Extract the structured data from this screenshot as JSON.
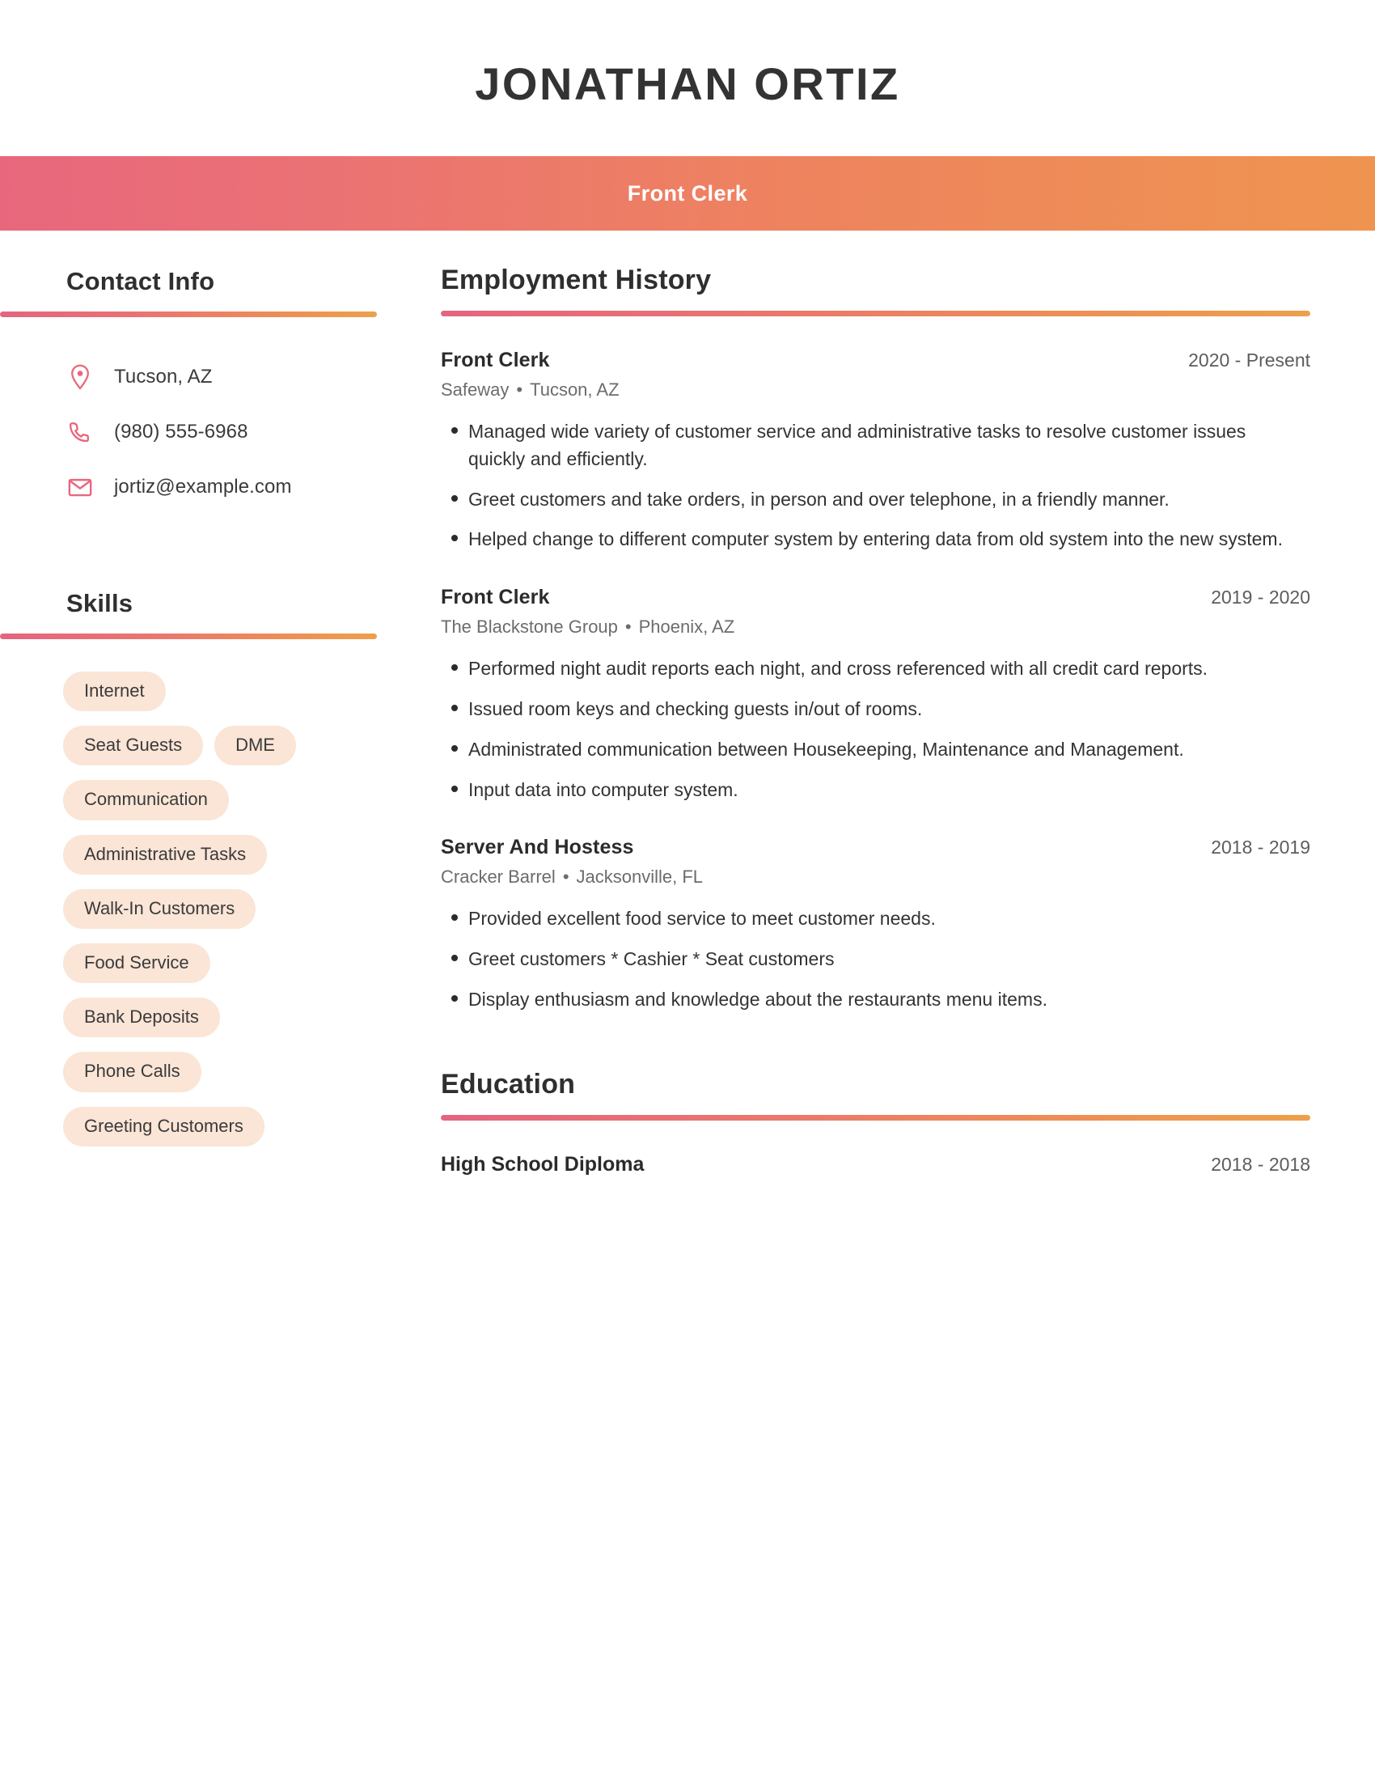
{
  "header": {
    "name": "JONATHAN ORTIZ",
    "job_title": "Front Clerk",
    "band_gradient_start": "#e8677d",
    "band_gradient_end": "#ef9450"
  },
  "sidebar": {
    "contact": {
      "heading": "Contact Info",
      "items": [
        {
          "icon": "location-pin-icon",
          "value": "Tucson, AZ"
        },
        {
          "icon": "phone-icon",
          "value": "(980) 555-6968"
        },
        {
          "icon": "envelope-icon",
          "value": "jortiz@example.com"
        }
      ]
    },
    "skills": {
      "heading": "Skills",
      "items": [
        "Internet",
        "Seat Guests",
        "DME",
        "Communication",
        "Administrative Tasks",
        "Walk-In Customers",
        "Food Service",
        "Bank Deposits",
        "Phone Calls",
        "Greeting Customers"
      ],
      "pill_background": "#fae5d6"
    }
  },
  "main": {
    "employment": {
      "heading": "Employment History",
      "jobs": [
        {
          "title": "Front Clerk",
          "dates": "2020 - Present",
          "company": "Safeway",
          "location": "Tucson, AZ",
          "bullets": [
            "Managed wide variety of customer service and administrative tasks to resolve customer issues quickly and efficiently.",
            "Greet customers and take orders, in person and over telephone, in a friendly manner.",
            "Helped change to different computer system by entering data from old system into the new system."
          ]
        },
        {
          "title": "Front Clerk",
          "dates": "2019 - 2020",
          "company": "The Blackstone Group",
          "location": "Phoenix, AZ",
          "bullets": [
            "Performed night audit reports each night, and cross referenced with all credit card reports.",
            "Issued room keys and checking guests in/out of rooms.",
            "Administrated communication between Housekeeping, Maintenance and Management.",
            "Input data into computer system."
          ]
        },
        {
          "title": "Server And Hostess",
          "dates": "2018 - 2019",
          "company": "Cracker Barrel",
          "location": "Jacksonville, FL",
          "bullets": [
            "Provided excellent food service to meet customer needs.",
            "Greet customers * Cashier * Seat customers",
            "Display enthusiasm and knowledge about the restaurants menu items."
          ]
        }
      ]
    },
    "education": {
      "heading": "Education",
      "entries": [
        {
          "degree": "High School Diploma",
          "dates": "2018 - 2018"
        }
      ]
    }
  },
  "separator": "•"
}
